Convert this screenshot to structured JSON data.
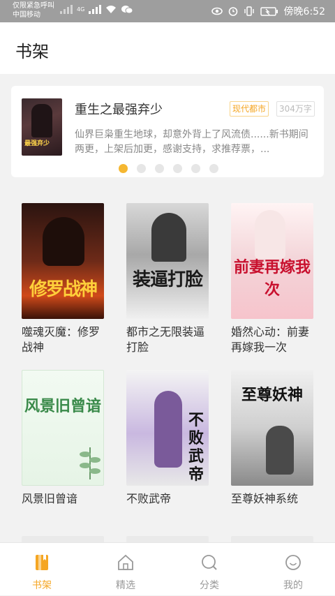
{
  "status_bar": {
    "left_line1": "仅限紧急呼叫",
    "left_line2": "中国移动",
    "network": "4G",
    "time": "傍晚6:52"
  },
  "header": {
    "title": "书架"
  },
  "featured": {
    "title": "重生之最强弃少",
    "genre_tag": "现代都市",
    "word_count": "304万字",
    "cover_title": "最强弃少",
    "description": "仙界巨枭重生地球，却意外背上了风流债......新书期间两更，上架后加更，感谢支持，求推荐票，...",
    "carousel_total": 6,
    "carousel_active_index": 0
  },
  "books": [
    {
      "title": "噬魂灭魔：修罗战神",
      "cover_text": "修罗战神"
    },
    {
      "title": "都市之无限装逼打脸",
      "cover_text": "装逼打脸"
    },
    {
      "title": "婚然心动：前妻再嫁我一次",
      "cover_text": "前妻再嫁我次"
    },
    {
      "title": "风景旧曾谙",
      "cover_text": "风景旧曾谙"
    },
    {
      "title": "不败武帝",
      "cover_text": "不败武帝"
    },
    {
      "title": "至尊妖神系统",
      "cover_text": "至尊妖神"
    }
  ],
  "tabs": [
    {
      "label": "书架",
      "icon": "bookshelf-icon",
      "active": true
    },
    {
      "label": "精选",
      "icon": "home-icon",
      "active": false
    },
    {
      "label": "分类",
      "icon": "search-icon",
      "active": false
    },
    {
      "label": "我的",
      "icon": "smiley-icon",
      "active": false
    }
  ],
  "colors": {
    "accent": "#f5a623",
    "dot_active": "#f5b731",
    "status_bar": "#9e9e9e"
  }
}
